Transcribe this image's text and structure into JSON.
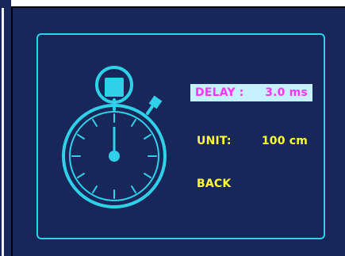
{
  "menu": {
    "items": [
      {
        "label": "DELAY :",
        "value": "3.0 ms",
        "selected": true
      },
      {
        "label": "UNIT:",
        "value": "100 cm",
        "selected": false
      },
      {
        "label": "BACK",
        "value": "",
        "selected": false
      }
    ]
  },
  "icons": {
    "main": "stopwatch-icon"
  },
  "colors": {
    "background": "#17275a",
    "frame": "#2fd1e8",
    "selected_bg": "#c6f2ff",
    "selected_text": "#ff33ff",
    "item_text": "#ffff33"
  }
}
